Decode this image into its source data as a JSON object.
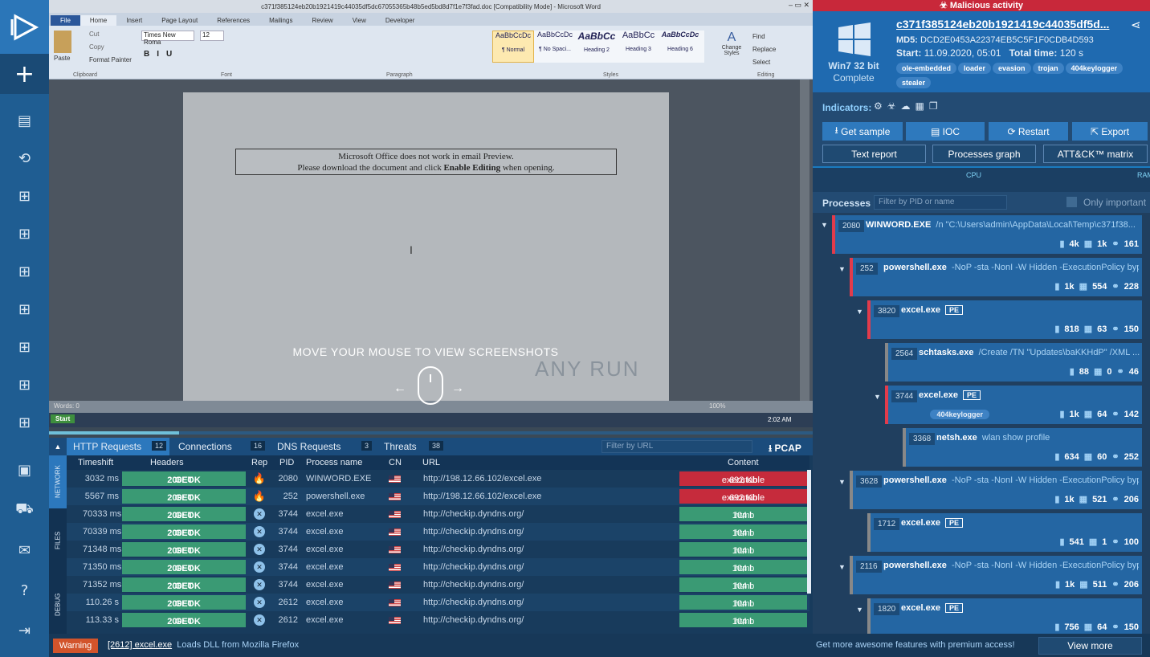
{
  "sidebar": {
    "logo": "anyrun-logo",
    "items": [
      "new-task-icon",
      "document-icon",
      "history-icon",
      "windows-icon",
      "windows-icon",
      "windows-icon",
      "windows-icon",
      "windows-icon",
      "windows-icon",
      "windows-icon",
      "contacts-icon",
      "cart-icon",
      "mail-icon",
      "help-icon",
      "logout-icon"
    ]
  },
  "word": {
    "title": "c371f385124eb20b1921419c44035df5dc67055365b48b5ed5bd8d7f1e7f3fad.doc [Compatibility Mode] - Microsoft Word",
    "tabs": [
      "File",
      "Home",
      "Insert",
      "Page Layout",
      "References",
      "Mailings",
      "Review",
      "View",
      "Developer"
    ],
    "clipboard": {
      "paste": "Paste",
      "cut": "Cut",
      "copy": "Copy",
      "format_painter": "Format Painter",
      "group": "Clipboard"
    },
    "font": {
      "name": "Times New Roma",
      "size": "12",
      "group": "Font"
    },
    "paragraph_group": "Paragraph",
    "styles": [
      {
        "preview": "AaBbCcDc",
        "name": "¶ Normal"
      },
      {
        "preview": "AaBbCcDc",
        "name": "¶ No Spaci..."
      },
      {
        "preview": "AaBbCc",
        "name": "Heading 2"
      },
      {
        "preview": "AaBbCc",
        "name": "Heading 3"
      },
      {
        "preview": "AaBbCcDc",
        "name": "Heading 6"
      }
    ],
    "styles_group": "Styles",
    "change_styles": "Change Styles",
    "editing": {
      "find": "Find",
      "replace": "Replace",
      "select": "Select",
      "group": "Editing"
    },
    "notice_line1": "Microsoft Office does not work in email Preview.",
    "notice_line2_pre": "Please download the document and click ",
    "notice_line2_bold": "Enable Editing",
    "notice_line2_post": " when opening.",
    "status_words": "Words: 0",
    "zoom": "100%",
    "taskbar_start": "Start",
    "clock": "2:02 AM",
    "watermark": "ANY RUN"
  },
  "overlay": {
    "message": "MOVE YOUR MOUSE TO VIEW SCREENSHOTS",
    "progress": 0.17
  },
  "right": {
    "banner": "Malicious activity",
    "hash": "c371f385124eb20b1921419c44035df5d...",
    "md5_label": "MD5:",
    "md5": "DCD2E0453A22374EB5C5F1F0CDB4D593",
    "start_label": "Start:",
    "start": "11.09.2020, 05:01",
    "total_label": "Total time:",
    "total": "120 s",
    "os": "Win7 32 bit",
    "status": "Complete",
    "tags": [
      "ole-embedded",
      "loader",
      "evasion",
      "trojan",
      "404keylogger",
      "stealer"
    ],
    "indicators_label": "Indicators:",
    "buttons": {
      "get_sample": "Get sample",
      "ioc": "IOC",
      "restart": "Restart",
      "export": "Export",
      "text_report": "Text report",
      "processes_graph": "Processes graph",
      "attck": "ATT&CK™ matrix"
    },
    "cpu": "CPU",
    "ram": "RAM",
    "processes_label": "Processes",
    "filter_placeholder": "Filter by PID or name",
    "only_important": "Only important",
    "processes": [
      {
        "pid": "2080",
        "name": "WINWORD.EXE",
        "cmd": "/n \"C:\\Users\\admin\\AppData\\Local\\Temp\\c371f38...",
        "files": "4k",
        "reg": "1k",
        "net": "161"
      },
      {
        "pid": "252",
        "name": "powershell.exe",
        "cmd": "-NoP -sta -NonI -W Hidden -ExecutionPolicy byp...",
        "files": "1k",
        "reg": "554",
        "net": "228"
      },
      {
        "pid": "3820",
        "name": "excel.exe",
        "cmd": "PE",
        "files": "818",
        "reg": "63",
        "net": "150"
      },
      {
        "pid": "2564",
        "name": "schtasks.exe",
        "cmd": "/Create /TN \"Updates\\baKKHdP\" /XML ...",
        "files": "88",
        "reg": "0",
        "net": "46"
      },
      {
        "pid": "3744",
        "name": "excel.exe",
        "cmd": "PE",
        "tag": "404keylogger",
        "files": "1k",
        "reg": "64",
        "net": "142"
      },
      {
        "pid": "3368",
        "name": "netsh.exe",
        "cmd": "wlan show profile",
        "files": "634",
        "reg": "60",
        "net": "252"
      },
      {
        "pid": "3628",
        "name": "powershell.exe",
        "cmd": "-NoP -sta -NonI -W Hidden -ExecutionPolicy byp...",
        "files": "1k",
        "reg": "521",
        "net": "206"
      },
      {
        "pid": "1712",
        "name": "excel.exe",
        "cmd": "PE",
        "files": "541",
        "reg": "1",
        "net": "100"
      },
      {
        "pid": "2116",
        "name": "powershell.exe",
        "cmd": "-NoP -sta -NonI -W Hidden -ExecutionPolicy byp...",
        "files": "1k",
        "reg": "511",
        "net": "206"
      },
      {
        "pid": "1820",
        "name": "excel.exe",
        "cmd": "PE",
        "files": "756",
        "reg": "64",
        "net": "150"
      }
    ]
  },
  "network": {
    "tabs": [
      {
        "label": "HTTP Requests",
        "count": "12"
      },
      {
        "label": "Connections",
        "count": "16"
      },
      {
        "label": "DNS Requests",
        "count": "3"
      },
      {
        "label": "Threats",
        "count": "38"
      }
    ],
    "filter_placeholder": "Filter by URL",
    "pcap": "PCAP",
    "side_tabs": [
      "NETWORK",
      "FILES",
      "DEBUG"
    ],
    "columns": [
      "Timeshift",
      "Headers",
      "Rep",
      "PID",
      "Process name",
      "CN",
      "URL",
      "Content"
    ],
    "rows": [
      {
        "time": "3032 ms",
        "method": "GET",
        "status": "200: OK",
        "rep": "danger",
        "pid": "2080",
        "proc": "WINWORD.EXE",
        "url": "http://198.12.66.102/excel.exe",
        "size": "692 Kb",
        "type": "executable",
        "color": "#c62b3c"
      },
      {
        "time": "5567 ms",
        "method": "GET",
        "status": "200: OK",
        "rep": "danger",
        "pid": "252",
        "proc": "powershell.exe",
        "url": "http://198.12.66.102/excel.exe",
        "size": "692 Kb",
        "type": "executable",
        "color": "#c62b3c"
      },
      {
        "time": "70333 ms",
        "method": "GET",
        "status": "200: OK",
        "rep": "safe",
        "pid": "3744",
        "proc": "excel.exe",
        "url": "http://checkip.dyndns.org/",
        "size": "104 b",
        "type": "html",
        "color": "#3a9a74"
      },
      {
        "time": "70339 ms",
        "method": "GET",
        "status": "200: OK",
        "rep": "safe",
        "pid": "3744",
        "proc": "excel.exe",
        "url": "http://checkip.dyndns.org/",
        "size": "104 b",
        "type": "html",
        "color": "#3a9a74"
      },
      {
        "time": "71348 ms",
        "method": "GET",
        "status": "200: OK",
        "rep": "safe",
        "pid": "3744",
        "proc": "excel.exe",
        "url": "http://checkip.dyndns.org/",
        "size": "104 b",
        "type": "html",
        "color": "#3a9a74"
      },
      {
        "time": "71350 ms",
        "method": "GET",
        "status": "200: OK",
        "rep": "safe",
        "pid": "3744",
        "proc": "excel.exe",
        "url": "http://checkip.dyndns.org/",
        "size": "104 b",
        "type": "html",
        "color": "#3a9a74"
      },
      {
        "time": "71352 ms",
        "method": "GET",
        "status": "200: OK",
        "rep": "safe",
        "pid": "3744",
        "proc": "excel.exe",
        "url": "http://checkip.dyndns.org/",
        "size": "104 b",
        "type": "html",
        "color": "#3a9a74"
      },
      {
        "time": "110.26 s",
        "method": "GET",
        "status": "200: OK",
        "rep": "safe",
        "pid": "2612",
        "proc": "excel.exe",
        "url": "http://checkip.dyndns.org/",
        "size": "104 b",
        "type": "html",
        "color": "#3a9a74"
      },
      {
        "time": "113.33 s",
        "method": "GET",
        "status": "200: OK",
        "rep": "safe",
        "pid": "2612",
        "proc": "excel.exe",
        "url": "http://checkip.dyndns.org/",
        "size": "104 b",
        "type": "html",
        "color": "#3a9a74"
      }
    ]
  },
  "footer": {
    "warning": "Warning",
    "warn_proc": "[2612] excel.exe",
    "warn_msg": "Loads DLL from Mozilla Firefox",
    "premium": "Get more awesome features with premium access!",
    "view_more": "View more"
  }
}
